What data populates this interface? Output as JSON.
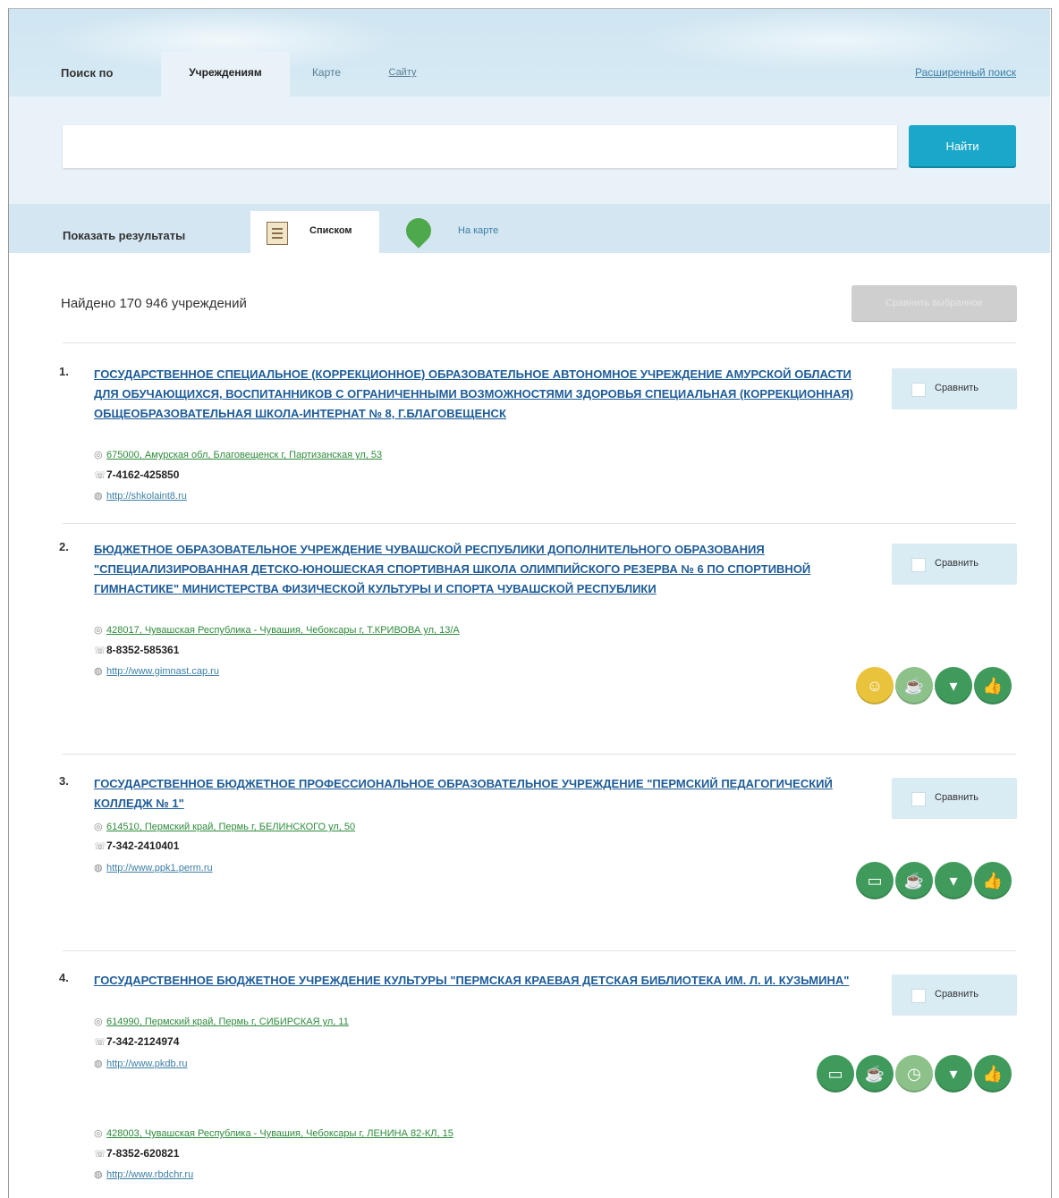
{
  "search": {
    "label": "Поиск по",
    "tabs": [
      "Учреждениям",
      "Карте",
      "Сайту"
    ],
    "advanced_link": "Расширенный поиск",
    "input_value": "",
    "placeholder": "",
    "button": "Найти"
  },
  "results_view": {
    "label": "Показать результаты",
    "list_label": "Списком",
    "map_label": "На карте"
  },
  "found_text": "Найдено 170 946 учреждений",
  "compare_selected": "Сравнить выбранное",
  "compare_label": "Сравнить",
  "items": [
    {
      "num": "1.",
      "title": "Государственное специальное (коррекционное) образовательное автономное учреждение Амурской области для обучающихся, воспитанников с ограниченными возможностями здоровья специальная (коррекционная) общеобразовательная школа-интернат № 8, г.Благовещенск",
      "address": "675000, Амурская обл, Благовещенск г, Партизанская ул, 53",
      "phone": "7-4162-425850",
      "site": "http://shkolaint8.ru",
      "badges": []
    },
    {
      "num": "2.",
      "title": "Бюджетное образовательное учреждение Чувашской Республики дополнительного образования \"Специализированная детско-юношеская спортивная школа олимпийского резерва № 6 по спортивной гимнастике\" Министерства физической культуры и спорта Чувашской Республики",
      "address": "428017, Чувашская Республика - Чувашия, Чебоксары г, Т.КРИВОВА ул, 13/А",
      "phone": "8-8352-585361",
      "site": "http://www.gimnast.cap.ru",
      "badges": [
        "smile-icon",
        "cup-icon",
        "tie-icon",
        "thumb-up-icon"
      ]
    },
    {
      "num": "3.",
      "title": "Государственное бюджетное профессиональное образовательное учреждение \"Пермский педагогический колледж № 1\"",
      "address": "614510, Пермский край, Пермь г, БЕЛИНСКОГО ул, 50",
      "phone": "7-342-2410401",
      "site": "http://www.ppk1.perm.ru",
      "badges": [
        "laptop-icon",
        "cup-icon",
        "tie-icon",
        "thumb-up-icon"
      ]
    },
    {
      "num": "4.",
      "title": "Государственное бюджетное учреждение культуры \"Пермская краевая детская библиотека им. Л. И. Кузьмина\"",
      "address": "614990, Пермский край, Пермь г, СИБИРСКАЯ ул, 11",
      "phone": "7-342-2124974",
      "site": "http://www.pkdb.ru",
      "extra_address": "428003, Чувашская Республика - Чувашия, Чебоксары г, ЛЕНИНА 82-КЛ, 15",
      "extra_phone": "7-8352-620821",
      "extra_site": "http://www.rbdchr.ru",
      "badges": [
        "laptop-icon",
        "cup-icon",
        "clock-icon",
        "tie-icon",
        "thumb-up-icon"
      ]
    }
  ],
  "colors": {
    "accent": "#1aa7c9",
    "link": "#1e5c98",
    "address": "#2e8b3c",
    "badge": "#3f9a5b",
    "badge_yellow": "#e8c33b"
  }
}
